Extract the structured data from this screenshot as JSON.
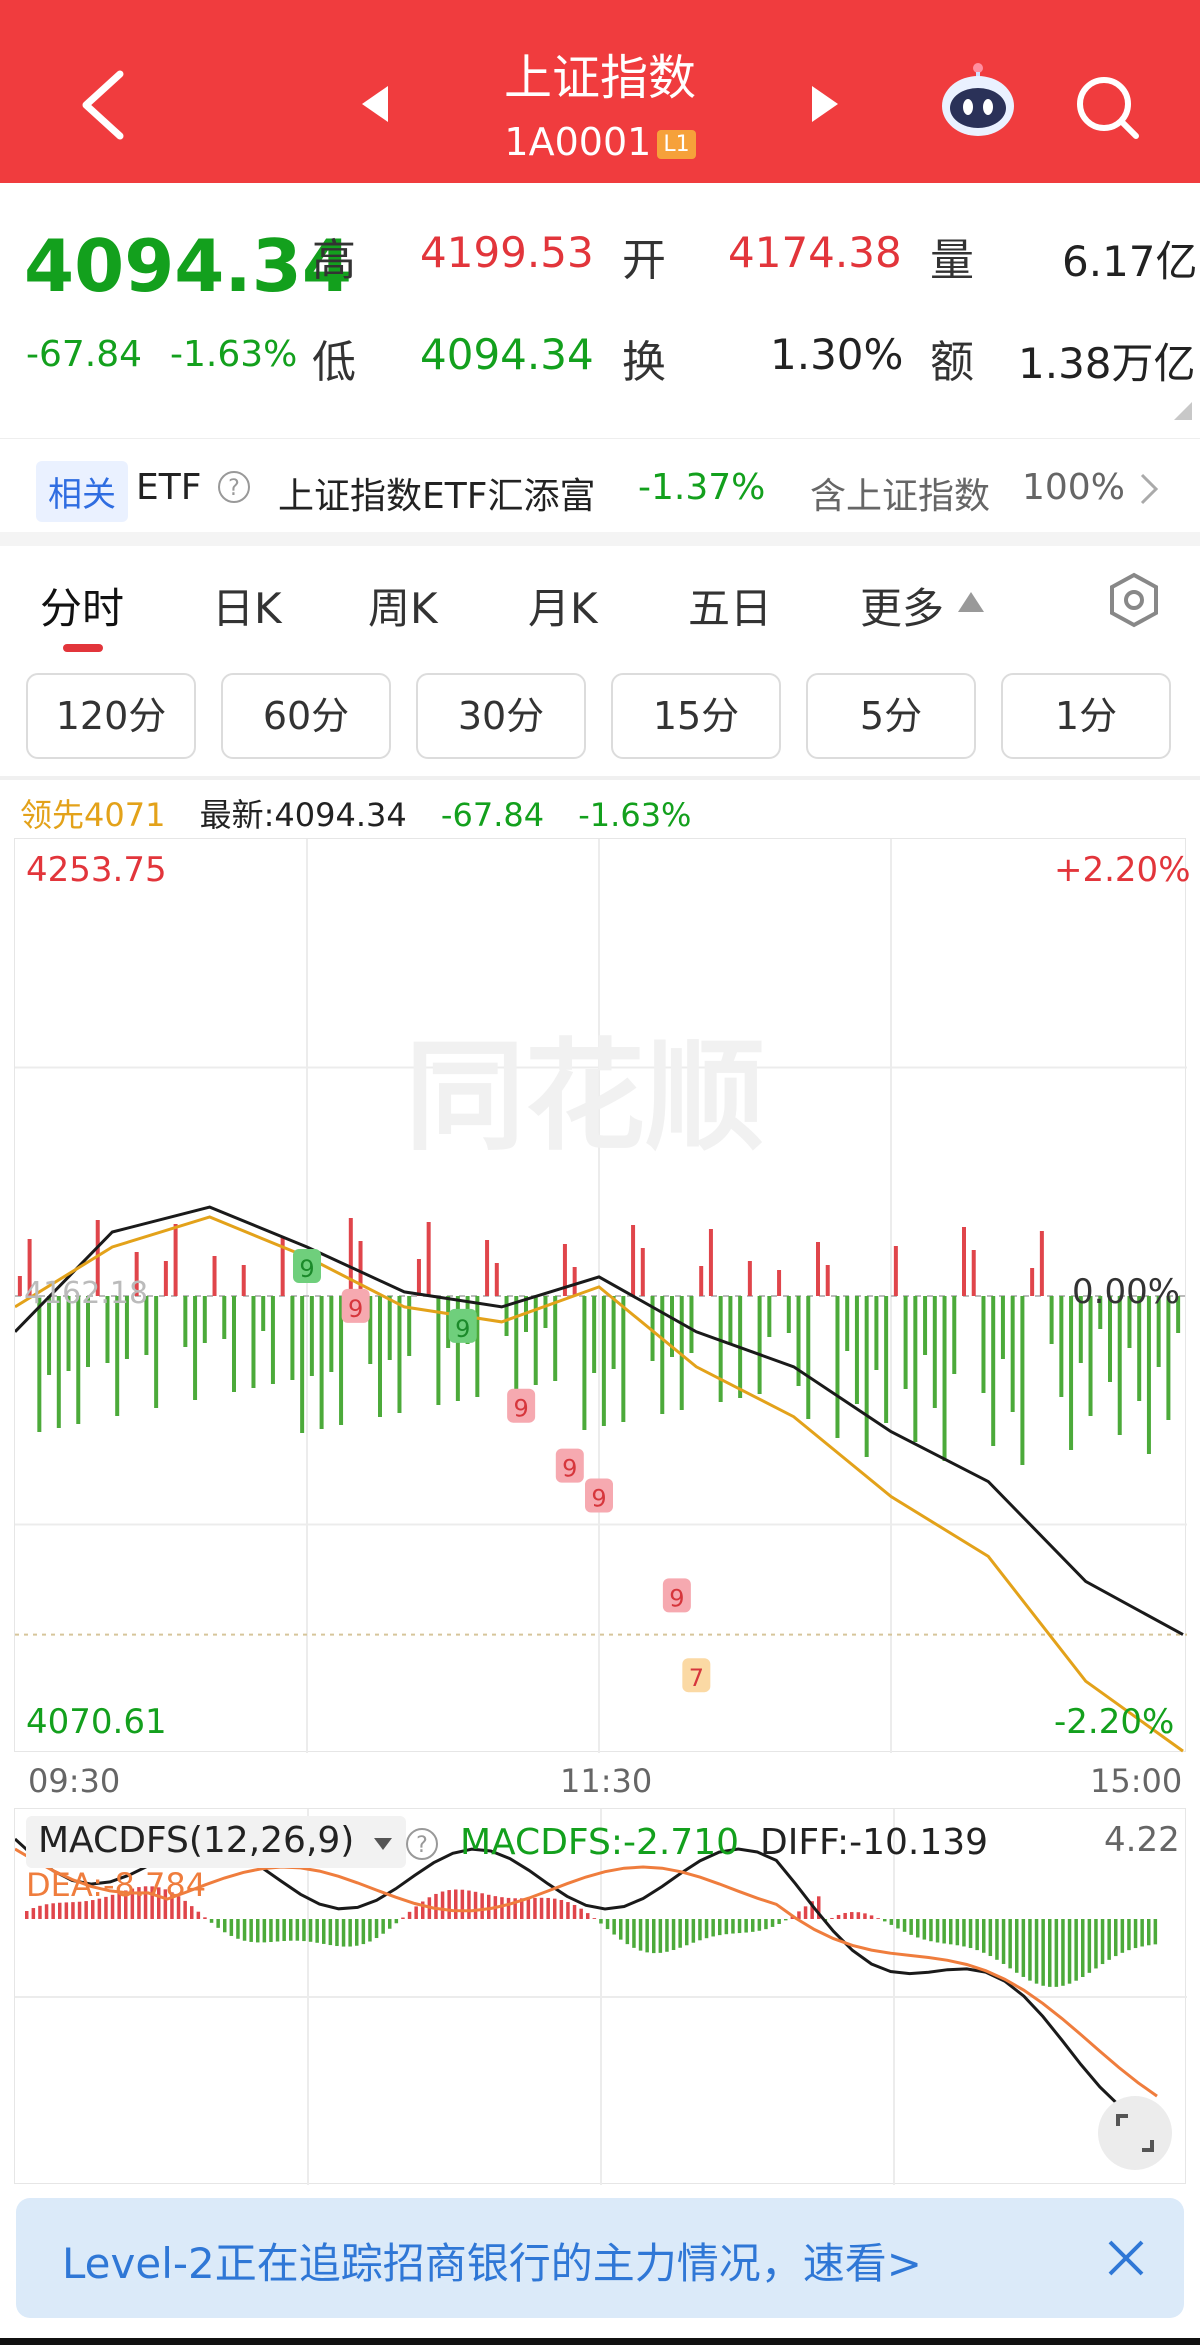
{
  "header": {
    "title": "上证指数",
    "code": "1A0001",
    "level_badge": "L1",
    "bg_color": "#f03c3e"
  },
  "quote": {
    "price": "4094.34",
    "change": "-67.84",
    "change_pct": "-1.63%",
    "high_label": "高",
    "high": "4199.53",
    "open_label": "开",
    "open": "4174.38",
    "volume_label": "量",
    "volume": "6.17亿",
    "low_label": "低",
    "low": "4094.34",
    "turnover_label": "换",
    "turnover": "1.30%",
    "amount_label": "额",
    "amount": "1.38万亿"
  },
  "related": {
    "tag": "相关",
    "etf_label": "ETF",
    "etf_name": "上证指数ETF汇添富",
    "etf_change": "-1.37%",
    "holding_label": "含上证指数",
    "holding_pct": "100%"
  },
  "tabs": [
    "分时",
    "日K",
    "周K",
    "月K",
    "五日",
    "更多"
  ],
  "periods": [
    "120分",
    "60分",
    "30分",
    "15分",
    "5分",
    "1分"
  ],
  "legend": {
    "leader": "领先4071",
    "latest": "最新:4094.34",
    "change": "-67.84",
    "pct": "-1.63%"
  },
  "main_chart": {
    "y_top": "4253.75",
    "y_bottom": "4070.61",
    "pct_top": "+2.20%",
    "pct_mid": "0.00%",
    "pct_bottom": "-2.20%",
    "prev_close_label": "4162.18",
    "x_labels": [
      "09:30",
      "11:30",
      "15:00"
    ],
    "watermark": "同花顺",
    "marker_labels": [
      "9",
      "9",
      "9",
      "9",
      "9",
      "9",
      "9",
      "7"
    ]
  },
  "macd": {
    "name": "MACDFS(12,26,9)",
    "macdfs": "MACDFS:-2.710",
    "diff": "DIFF:-10.139",
    "dea": "DEA:-8.784",
    "y_top": "4.22"
  },
  "banner": {
    "text": "Level-2正在追踪招商银行的主力情况，速看>"
  },
  "chart_data": {
    "type": "line",
    "x_ticks": [
      "09:30",
      "11:30",
      "15:00"
    ],
    "ylim": [
      4070.61,
      4253.75
    ],
    "prev_close": 4162.18,
    "series": [
      {
        "name": "最新",
        "color": "#1a1a1a",
        "x": [
          0,
          20,
          40,
          60,
          80,
          100,
          120,
          140,
          160,
          180,
          200,
          220,
          240
        ],
        "values": [
          4155,
          4175,
          4180,
          4172,
          4163,
          4160,
          4166,
          4155,
          4148,
          4135,
          4125,
          4105,
          4094.34
        ]
      },
      {
        "name": "领先",
        "color": "#e3a21a",
        "x": [
          0,
          20,
          40,
          60,
          80,
          100,
          120,
          140,
          160,
          180,
          200,
          220,
          240
        ],
        "values": [
          4160,
          4172,
          4178,
          4170,
          4160,
          4157,
          4164,
          4148,
          4138,
          4122,
          4110,
          4085,
          4071
        ]
      }
    ]
  }
}
